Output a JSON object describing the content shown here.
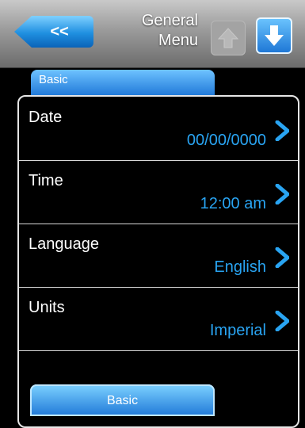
{
  "header": {
    "back_label": "<<",
    "title_line1": "General",
    "title_line2": "Menu",
    "up_icon": "arrow-up-icon",
    "down_icon": "arrow-down-icon"
  },
  "tabs": {
    "top_label": "Basic",
    "bottom_label": "Basic"
  },
  "rows": [
    {
      "label": "Date",
      "value": "00/00/0000"
    },
    {
      "label": "Time",
      "value": "12:00 am"
    },
    {
      "label": "Language",
      "value": "English"
    },
    {
      "label": "Units",
      "value": "Imperial"
    }
  ],
  "colors": {
    "accent": "#29a4f2",
    "header_gray": "#9a9a9a",
    "background": "#000000"
  }
}
